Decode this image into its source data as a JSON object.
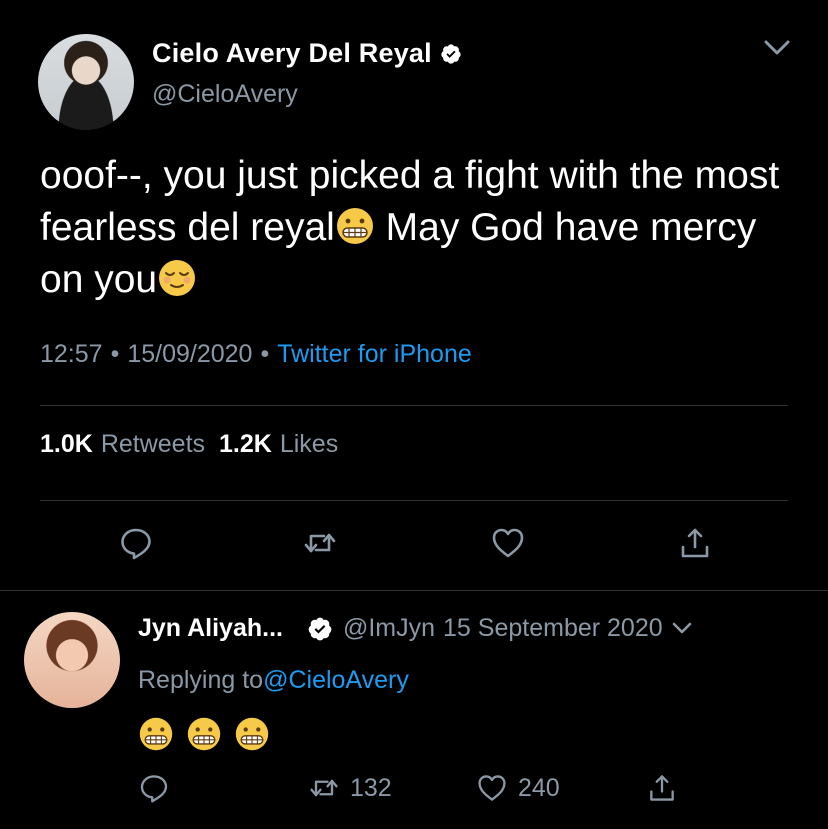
{
  "main_tweet": {
    "display_name": "Cielo Avery Del Reyal",
    "handle": "@CieloAvery",
    "text_part1": "ooof--, you just picked a fight with the most fearless del reyal",
    "text_part2": " May God have mercy on you",
    "emoji1": "grimacing-face",
    "emoji2": "relieved-face",
    "time": "12:57",
    "date": "15/09/2020",
    "source": "Twitter for iPhone",
    "retweet_count": "1.0K",
    "retweet_label": "Retweets",
    "like_count": "1.2K",
    "like_label": "Likes",
    "separator": "•"
  },
  "reply_tweet": {
    "display_name": "Jyn Aliyah...",
    "handle": "@ImJyn",
    "date": "15 September 2020",
    "replying_label": "Replying to",
    "replying_to": "@CieloAvery",
    "retweet_count": "132",
    "like_count": "240"
  },
  "colors": {
    "background": "#000000",
    "text_primary": "#ffffff",
    "text_secondary": "#8b98a5",
    "accent": "#1d9bf0",
    "divider": "#2f3336"
  }
}
